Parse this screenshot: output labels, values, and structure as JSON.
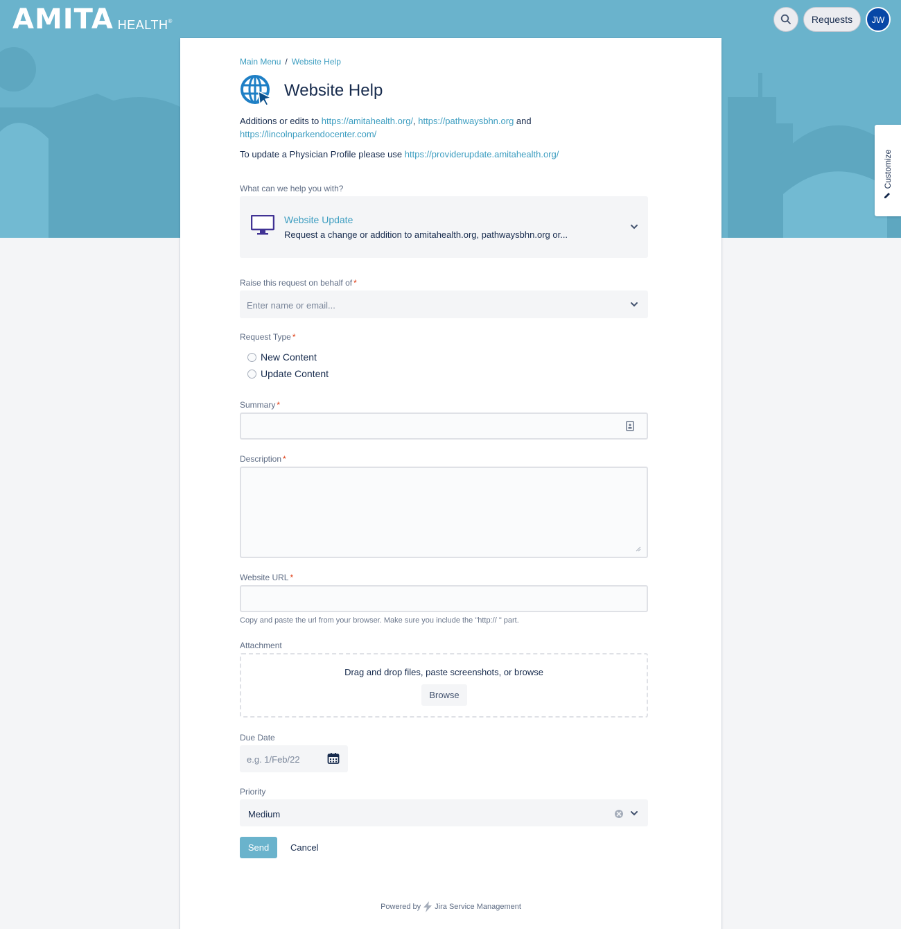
{
  "header": {
    "logo_main": "AMITA",
    "logo_sub": "HEALTH",
    "logo_reg": "®",
    "requests_label": "Requests",
    "avatar_initials": "JW",
    "customize_label": "Customize"
  },
  "breadcrumb": {
    "items": [
      "Main Menu",
      "Website Help"
    ],
    "separator": "/"
  },
  "page": {
    "title": "Website Help",
    "intro_prefix": "Additions or edits to ",
    "intro_link1": "https://amitahealth.org/",
    "intro_comma": ", ",
    "intro_link2": "https://pathwaysbhn.org",
    "intro_and": " and ",
    "intro_link3": "https://lincolnparkendocenter.com/",
    "profile_prefix": "To update a Physician Profile please use ",
    "profile_link": "https://providerupdate.amitahealth.org/"
  },
  "form": {
    "help_label": "What can we help you with?",
    "request_type_name": "Website Update",
    "request_type_desc": "Request a change or addition to amitahealth.org, pathwaysbhn.org or...",
    "on_behalf_label": "Raise this request on behalf of",
    "on_behalf_placeholder": "Enter name or email...",
    "request_type_label": "Request Type",
    "request_type_options": [
      "New Content",
      "Update Content"
    ],
    "summary_label": "Summary",
    "description_label": "Description",
    "website_url_label": "Website URL",
    "website_url_help": "Copy and paste the url from your browser. Make sure you include the \"http:// \" part.",
    "attachment_label": "Attachment",
    "attachment_message": "Drag and drop files, paste screenshots, or browse",
    "browse_label": "Browse",
    "due_date_label": "Due Date",
    "due_date_placeholder": "e.g. 1/Feb/22",
    "priority_label": "Priority",
    "priority_value": "Medium",
    "required_marker": "*",
    "send_label": "Send",
    "cancel_label": "Cancel"
  },
  "footer": {
    "powered_by": "Powered by",
    "product": "Jira Service Management"
  },
  "colors": {
    "banner": "#6ab3cc",
    "link": "#3c9dc0",
    "avatar": "#0747a6",
    "required": "#de350b"
  }
}
